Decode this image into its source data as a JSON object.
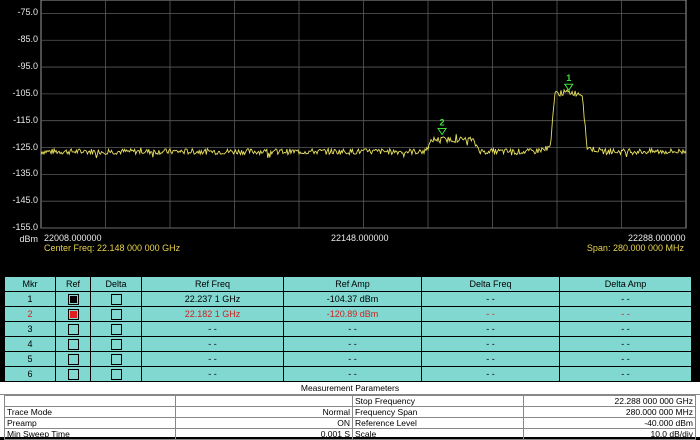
{
  "plot": {
    "y_unit": "dBm",
    "y_ticks": [
      "-75.0",
      "-85.0",
      "-95.0",
      "-105.0",
      "-115.0",
      "-125.0",
      "-135.0",
      "-145.0",
      "-155.0"
    ],
    "x_ticks": [
      "22008.000000",
      "22148.000000",
      "22288.000000"
    ],
    "center_freq": "Center Freq: 22.148 000 000 GHz",
    "span": "Span: 280.000 000 MHz",
    "marker1_label": "1",
    "marker2_label": "2",
    "trace_color": "#e8e060",
    "marker_color": "#40e040"
  },
  "chart_data": {
    "type": "line",
    "xlabel": "",
    "ylabel": "dBm",
    "xlim": [
      22008.0,
      22288.0
    ],
    "ylim": [
      -155.0,
      -70.0
    ],
    "series": [
      {
        "name": "",
        "x": [
          22008,
          22120,
          22175,
          22178,
          22195,
          22199,
          22222,
          22229,
          22231,
          22237,
          22243,
          22245,
          22252,
          22288
        ],
        "y": [
          -126.5,
          -126.5,
          -126.5,
          -122,
          -122,
          -126.5,
          -126.5,
          -125,
          -105,
          -104.4,
          -105,
          -125,
          -126.5,
          -126.5
        ]
      }
    ],
    "markers": [
      {
        "label": "1",
        "x": 22237.1,
        "y": -104.37
      },
      {
        "label": "2",
        "x": 22182.1,
        "y": -120.89
      }
    ]
  },
  "markers_table": {
    "headers": [
      "Mkr",
      "Ref",
      "Delta",
      "Ref Freq",
      "Ref Amp",
      "Delta Freq",
      "Delta Amp"
    ],
    "rows": [
      {
        "mkr": "1",
        "ref_freq": "22.237 1 GHz",
        "ref_amp": "-104.37 dBm",
        "delta_freq": "- -",
        "delta_amp": "- -"
      },
      {
        "mkr": "2",
        "ref_freq": "22.182 1 GHz",
        "ref_amp": "-120.89 dBm",
        "delta_freq": "- -",
        "delta_amp": "- -"
      },
      {
        "mkr": "3",
        "ref_freq": "- -",
        "ref_amp": "- -",
        "delta_freq": "- -",
        "delta_amp": "- -"
      },
      {
        "mkr": "4",
        "ref_freq": "- -",
        "ref_amp": "- -",
        "delta_freq": "- -",
        "delta_amp": "- -"
      },
      {
        "mkr": "5",
        "ref_freq": "- -",
        "ref_amp": "- -",
        "delta_freq": "- -",
        "delta_amp": "- -"
      },
      {
        "mkr": "6",
        "ref_freq": "- -",
        "ref_amp": "- -",
        "delta_freq": "- -",
        "delta_amp": "- -"
      }
    ]
  },
  "params": {
    "title": "Measurement Parameters",
    "rows": [
      {
        "l_label": "",
        "l_value": "",
        "r_label": "Stop Frequency",
        "r_value": "22.288 000 000 GHz"
      },
      {
        "l_label": "Trace Mode",
        "l_value": "Normal",
        "r_label": "Frequency Span",
        "r_value": "280.000 000 MHz"
      },
      {
        "l_label": "Preamp",
        "l_value": "ON",
        "r_label": "Reference Level",
        "r_value": "-40.000  dBm"
      },
      {
        "l_label": "Min Sweep Time",
        "l_value": "0.001 S",
        "r_label": "Scale",
        "r_value": "10.0  dB/div"
      }
    ]
  }
}
